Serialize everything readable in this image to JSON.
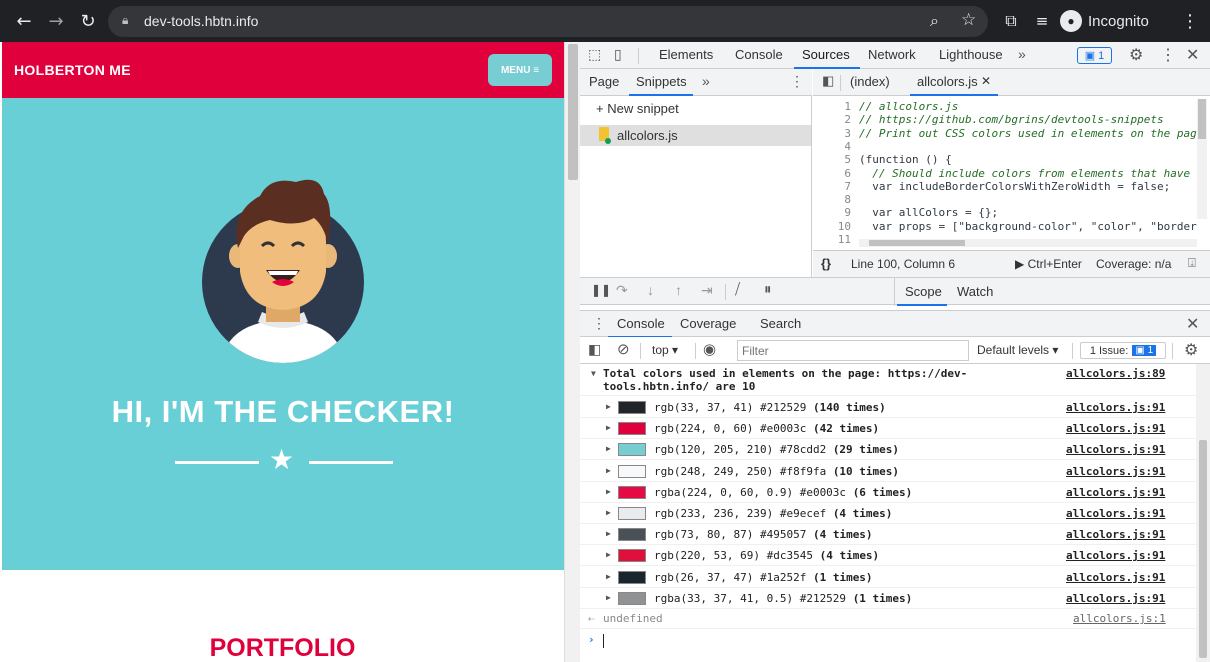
{
  "browser": {
    "url": "dev-tools.hbtn.info",
    "incognito_label": "Incognito"
  },
  "site": {
    "brand": "HOLBERTON ME",
    "menu_label": "MENU ≡",
    "hero_title": "HI, I'M THE CHECKER!",
    "portfolio_heading": "PORTFOLIO"
  },
  "devtools": {
    "tabs": [
      "Elements",
      "Console",
      "Sources",
      "Network",
      "Lighthouse"
    ],
    "active_tab": "Sources",
    "issues_count": "1",
    "nav_tabs": [
      "Page",
      "Snippets"
    ],
    "new_snippet": "New snippet",
    "snippet_file": "allcolors.js",
    "editor_tabs": [
      "(index)",
      "allcolors.js"
    ],
    "code_lines": [
      {
        "n": "1",
        "text": "// allcolors.js",
        "kind": "comment"
      },
      {
        "n": "2",
        "text": "// https://github.com/bgrins/devtools-snippets",
        "kind": "comment"
      },
      {
        "n": "3",
        "text": "// Print out CSS colors used in elements on the pag",
        "kind": "comment"
      },
      {
        "n": "4",
        "text": "",
        "kind": "plain"
      },
      {
        "n": "5",
        "text": "(function () {",
        "kind": "plain"
      },
      {
        "n": "6",
        "text": "  // Should include colors from elements that have",
        "kind": "comment"
      },
      {
        "n": "7",
        "text": "  var includeBorderColorsWithZeroWidth = false;",
        "kind": "plain"
      },
      {
        "n": "8",
        "text": "",
        "kind": "plain"
      },
      {
        "n": "9",
        "text": "  var allColors = {};",
        "kind": "plain"
      },
      {
        "n": "10",
        "text": "  var props = [\"background-color\", \"color\", \"border",
        "kind": "plain"
      },
      {
        "n": "11",
        "text": "",
        "kind": "plain"
      }
    ],
    "status_position": "Line 100, Column 6",
    "status_run": "Ctrl+Enter",
    "status_coverage": "Coverage: n/a",
    "scope_tabs": [
      "Scope",
      "Watch"
    ],
    "drawer_tabs": [
      "Console",
      "Coverage",
      "Search"
    ],
    "context": "top",
    "filter_placeholder": "Filter",
    "levels": "Default levels",
    "issue_badge": "1 Issue:",
    "issue_badge_count": "1",
    "console_heading": "Total colors used in elements on the page: https://dev-tools.hbtn.info/ are 10",
    "console_heading_link": "allcolors.js:89",
    "colors": [
      {
        "label": "rgb(33, 37, 41) #212529",
        "times": "(140 times)",
        "hex": "#212529",
        "link": "allcolors.js:91"
      },
      {
        "label": "rgb(224, 0, 60) #e0003c",
        "times": "(42 times)",
        "hex": "#e0003c",
        "link": "allcolors.js:91"
      },
      {
        "label": "rgb(120, 205, 210) #78cdd2",
        "times": "(29 times)",
        "hex": "#78cdd2",
        "link": "allcolors.js:91"
      },
      {
        "label": "rgb(248, 249, 250) #f8f9fa",
        "times": "(10 times)",
        "hex": "#f8f9fa",
        "link": "allcolors.js:91"
      },
      {
        "label": "rgba(224, 0, 60, 0.9) #e0003c",
        "times": "(6 times)",
        "hex": "#e60a44",
        "link": "allcolors.js:91"
      },
      {
        "label": "rgb(233, 236, 239) #e9ecef",
        "times": "(4 times)",
        "hex": "#e9ecef",
        "link": "allcolors.js:91"
      },
      {
        "label": "rgb(73, 80, 87) #495057",
        "times": "(4 times)",
        "hex": "#495057",
        "link": "allcolors.js:91"
      },
      {
        "label": "rgb(220, 53, 69) #dc3545",
        "times": "(4 times)",
        "hex": "#e0103c",
        "link": "allcolors.js:91"
      },
      {
        "label": "rgb(26, 37, 47) #1a252f",
        "times": "(1 times)",
        "hex": "#1a252f",
        "link": "allcolors.js:91"
      },
      {
        "label": "rgba(33, 37, 41, 0.5) #212529",
        "times": "(1 times)",
        "hex": "#909294",
        "link": "allcolors.js:91"
      }
    ],
    "undefined_text": "undefined",
    "undefined_link": "allcolors.js:1"
  }
}
